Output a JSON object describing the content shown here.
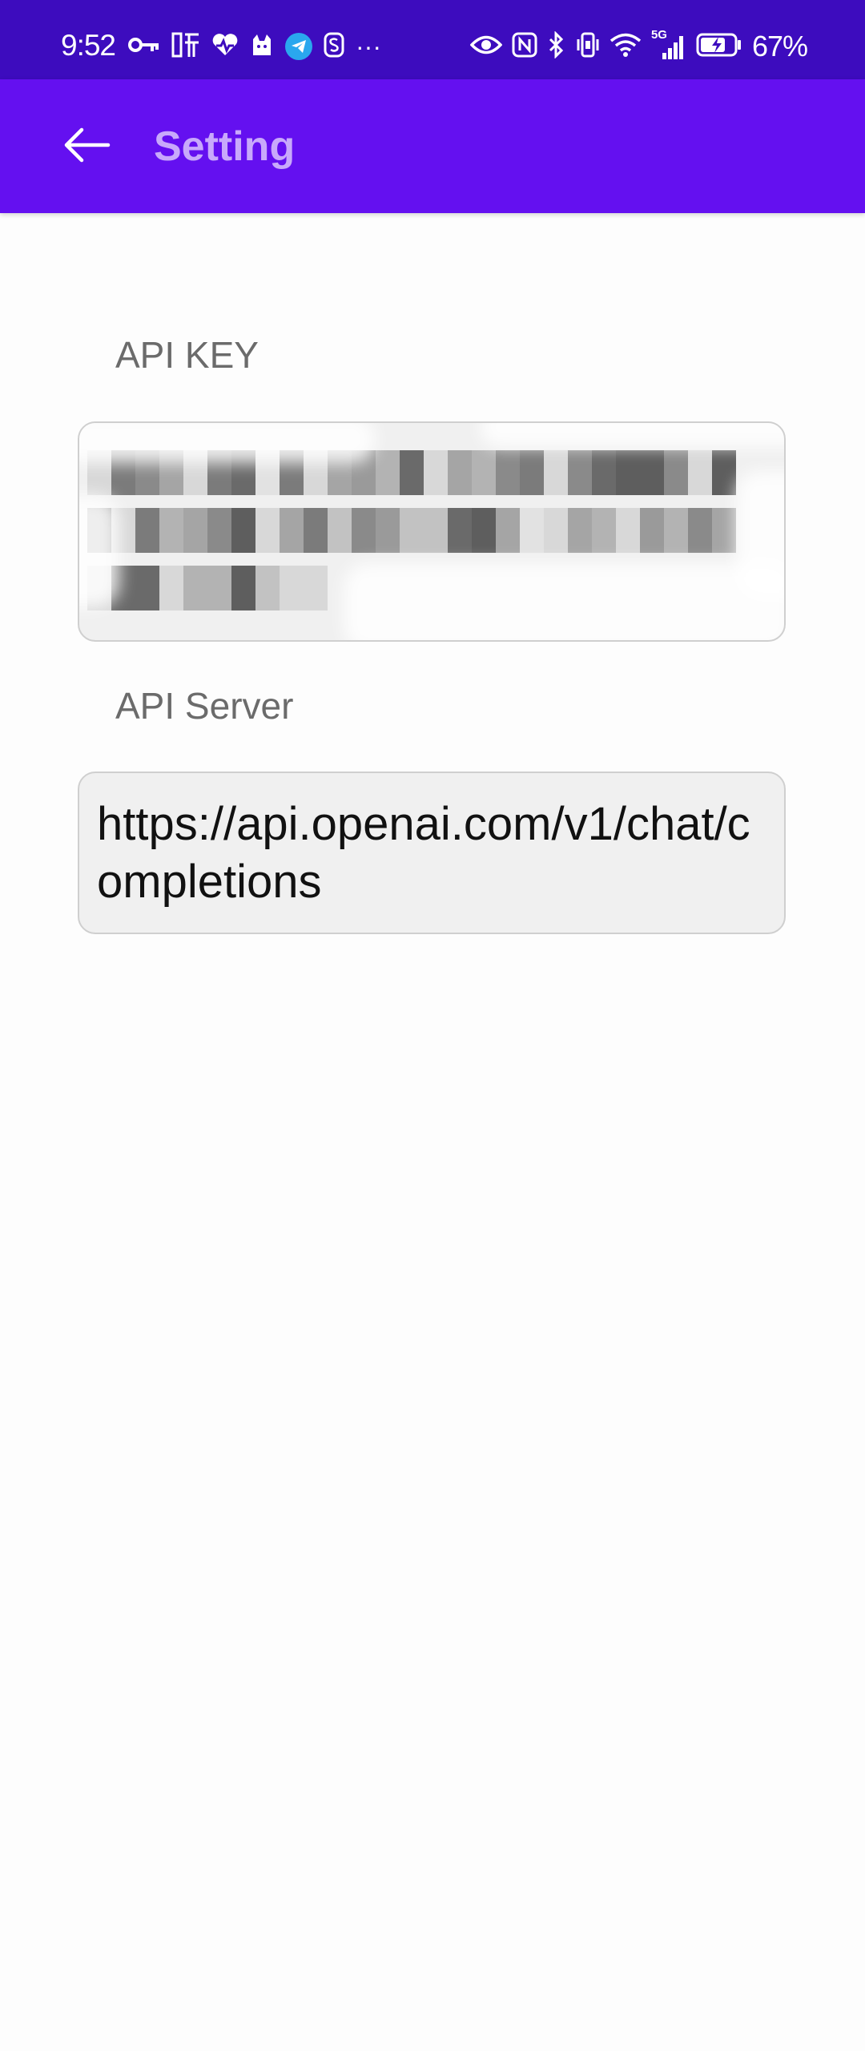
{
  "status_bar": {
    "time": "9:52",
    "left_icons": [
      "key-icon",
      "listen-icon",
      "heart-pulse-icon",
      "cat-icon",
      "telegram-icon",
      "s-app-icon",
      "more-dots-icon"
    ],
    "more": "···",
    "right_icons": [
      "eye-icon",
      "nfc-icon",
      "bluetooth-icon",
      "vibrate-icon",
      "wifi-icon",
      "signal-5g-icon",
      "battery-charging-icon"
    ],
    "network": "5G",
    "battery": "67%"
  },
  "app_bar": {
    "title": "Setting",
    "back_icon": "arrow-left-icon",
    "colors": {
      "status": "#3d0cbe",
      "bar": "#6410f0",
      "title": "#c8a9fb"
    }
  },
  "fields": {
    "api_key": {
      "label": "API KEY",
      "value_obscured": true
    },
    "api_server": {
      "label": "API Server",
      "value": "https://api.openai.com/v1/chat/completions"
    }
  }
}
